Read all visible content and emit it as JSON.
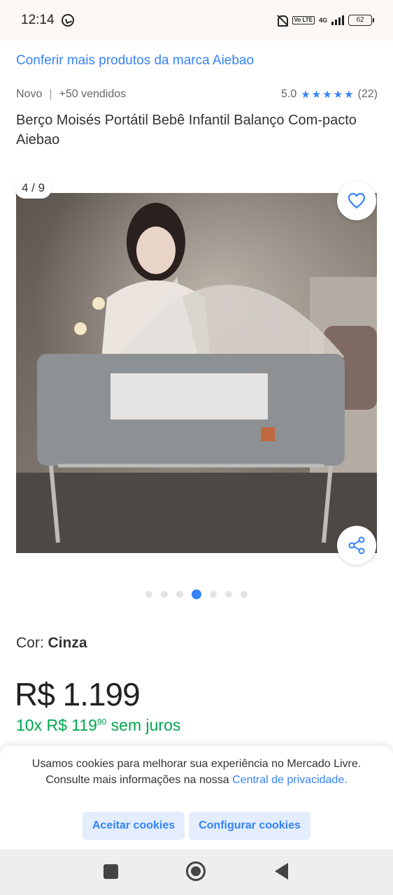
{
  "status_bar": {
    "time": "12:14",
    "volte": "Vo LTE",
    "network": "4G",
    "battery": "62"
  },
  "product": {
    "brand_link": "Conferir mais produtos da marca Aiebao",
    "condition": "Novo",
    "separator": "|",
    "sold": "+50 vendidos",
    "rating": "5.0",
    "star_count": 5,
    "reviews": "(22)",
    "title": "Berço Moisés Portátil Bebê Infantil Balanço Com-pacto Aiebao"
  },
  "gallery": {
    "counter": "4 / 9",
    "total_images": 7,
    "active_index": 3
  },
  "variant": {
    "label": "Cor: ",
    "value": "Cinza"
  },
  "pricing": {
    "price": "R$ 1.199",
    "installment_prefix": "10x R$ 119",
    "installment_cents": "90",
    "installment_suffix": " sem juros"
  },
  "cookie_banner": {
    "text": "Usamos cookies para melhorar sua experiência no Mercado Livre. Consulte mais informações na nossa ",
    "link": "Central de privacidade.",
    "accept_label": "Aceitar cookies",
    "config_label": "Configurar cookies"
  },
  "colors": {
    "accent": "#3483fa",
    "price_green": "#00a650"
  },
  "icons": [
    "whatsapp-icon",
    "bell-off-icon",
    "signal-icon",
    "battery-icon",
    "star-icon",
    "heart-icon",
    "share-icon",
    "nav-recents-icon",
    "nav-home-icon",
    "nav-back-icon"
  ]
}
